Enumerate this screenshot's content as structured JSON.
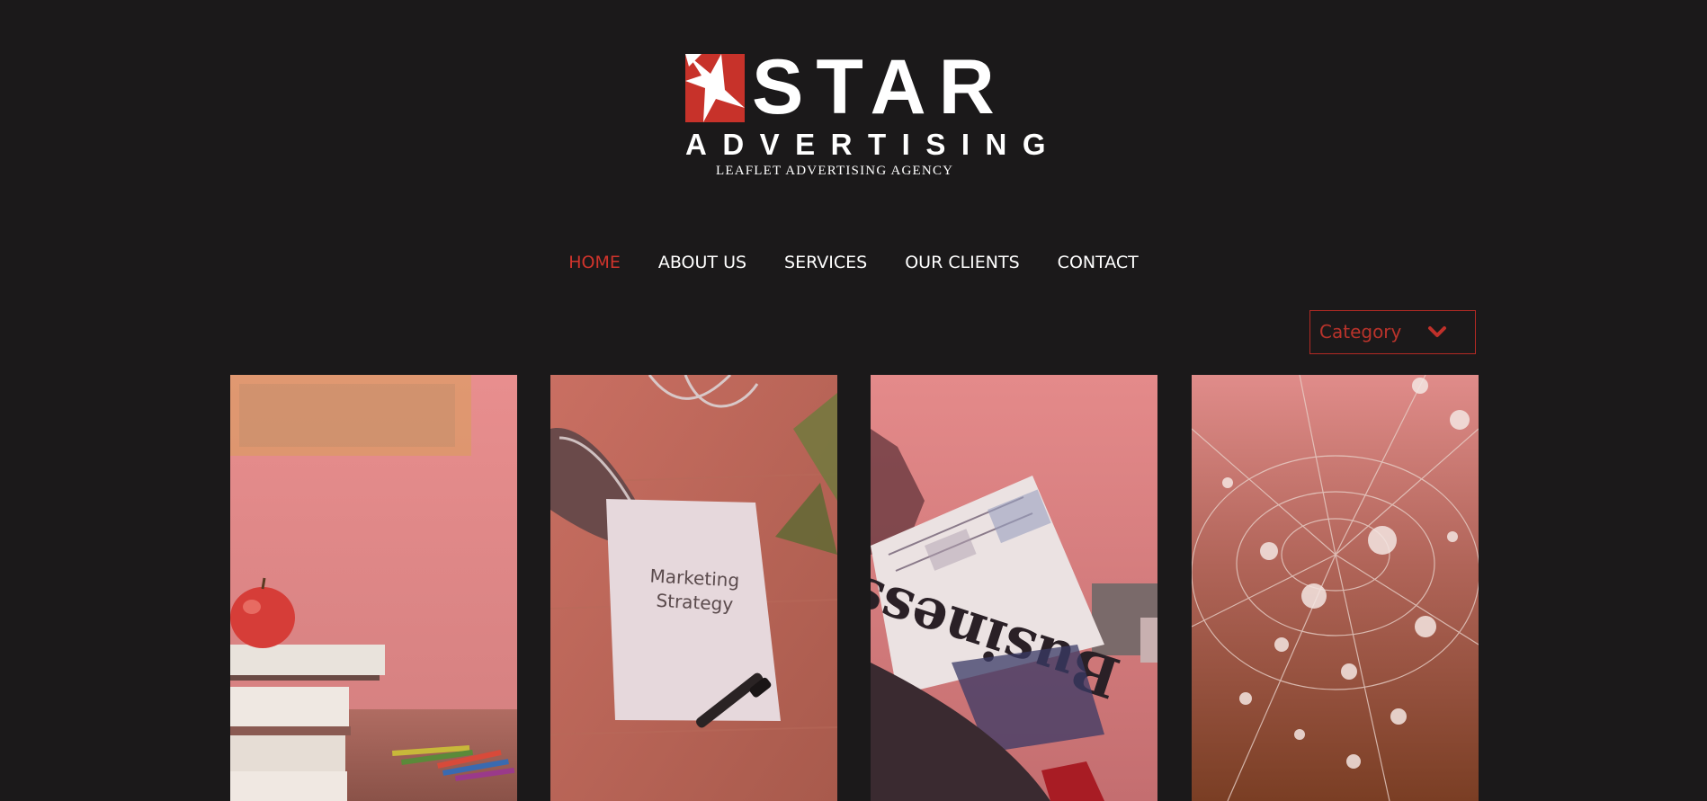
{
  "logo": {
    "word": "STAR",
    "sub": "ADVERTISING",
    "tagline": "LEAFLET ADVERTISING AGENCY"
  },
  "nav": {
    "items": [
      {
        "label": "HOME",
        "active": true
      },
      {
        "label": "ABOUT US",
        "active": false
      },
      {
        "label": "SERVICES",
        "active": false
      },
      {
        "label": "OUR CLIENTS",
        "active": false
      },
      {
        "label": "CONTACT",
        "active": false
      }
    ]
  },
  "filter": {
    "category_label": "Category",
    "icon": "chevron-down-icon"
  },
  "gallery": {
    "cards": [
      {
        "image": "apple-on-books",
        "icon": "image"
      },
      {
        "image": "marketing-strategy-note",
        "text_line1": "Marketing",
        "text_line2": "Strategy"
      },
      {
        "image": "business-newspaper",
        "text": "Business"
      },
      {
        "image": "dew-spider-web"
      }
    ]
  },
  "colors": {
    "background": "#1b191a",
    "accent": "#d0342c",
    "overlay": "#e8606a",
    "text": "#ffffff"
  }
}
